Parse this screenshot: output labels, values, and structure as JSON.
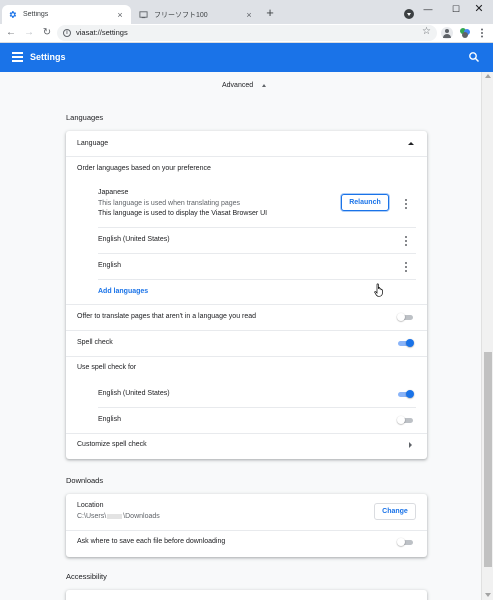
{
  "browser": {
    "tabs": [
      {
        "title": "Settings",
        "active": true
      },
      {
        "title": "フリーソフト100",
        "active": false
      }
    ],
    "new_tab_label": "+",
    "address": "viasat://settings"
  },
  "header": {
    "title": "Settings"
  },
  "advanced": {
    "label": "Advanced"
  },
  "languages": {
    "section_title": "Languages",
    "card_header": "Language",
    "order_label": "Order languages based on your preference",
    "items": [
      {
        "name": "Japanese",
        "note1": "This language is used when translating pages",
        "note2": "This language is used to display the Viasat Browser UI",
        "button": "Relaunch"
      },
      {
        "name": "English (United States)"
      },
      {
        "name": "English"
      }
    ],
    "add_languages": "Add languages",
    "offer_translate": {
      "label": "Offer to translate pages that aren't in a language you read",
      "enabled": false
    },
    "spell_check": {
      "label": "Spell check",
      "enabled": true
    },
    "use_spell_check_for": "Use spell check for",
    "spell_langs": [
      {
        "name": "English (United States)",
        "enabled": true
      },
      {
        "name": "English",
        "enabled": false
      }
    ],
    "customize": "Customize spell check"
  },
  "downloads": {
    "section_title": "Downloads",
    "location_label": "Location",
    "location_prefix": "C:\\Users\\",
    "location_suffix": "\\Downloads",
    "change_button": "Change",
    "ask_where": {
      "label": "Ask where to save each file before downloading",
      "enabled": false
    }
  },
  "accessibility": {
    "section_title": "Accessibility"
  },
  "colors": {
    "accent": "#1a73e8",
    "header_bg": "#1a73e8",
    "page_bg": "#f8f9fa"
  }
}
